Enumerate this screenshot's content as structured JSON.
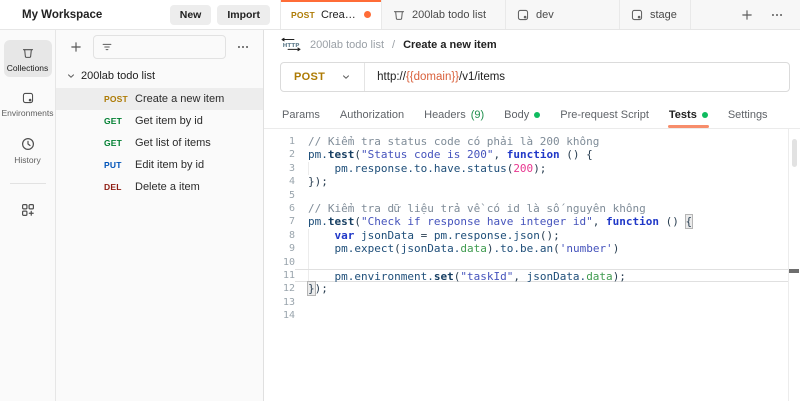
{
  "colors": {
    "accent_orange": "#ff6c37",
    "method_post": "#ad7a03",
    "method_get": "#007f31",
    "method_put": "#0053b8",
    "method_del": "#8e1a10",
    "green_dot": "#0fbb5f",
    "url_variable": "#d9603b"
  },
  "topbar": {
    "workspace": "My Workspace",
    "new_button": "New",
    "import_button": "Import",
    "tabs": [
      {
        "kind": "request",
        "method": "POST",
        "label": "Create a new item",
        "active": true,
        "dirty": true
      },
      {
        "kind": "collection",
        "label": "200lab todo list",
        "active": false,
        "dirty": false
      },
      {
        "kind": "environment",
        "label": "dev",
        "active": false,
        "dirty": false
      },
      {
        "kind": "environment",
        "label": "stage",
        "active": false,
        "dirty": false
      }
    ]
  },
  "rail": {
    "items": [
      {
        "id": "collections",
        "label": "Collections",
        "active": true
      },
      {
        "id": "environments",
        "label": "Environments",
        "active": false
      },
      {
        "id": "history",
        "label": "History",
        "active": false
      }
    ]
  },
  "sidebar": {
    "collection_name": "200lab todo list",
    "requests": [
      {
        "method": "POST",
        "label": "Create a new item",
        "selected": true
      },
      {
        "method": "GET",
        "label": "Get item by id",
        "selected": false
      },
      {
        "method": "GET",
        "label": "Get list of items",
        "selected": false
      },
      {
        "method": "PUT",
        "label": "Edit item by id",
        "selected": false
      },
      {
        "method": "DEL",
        "label": "Delete a item",
        "selected": false
      }
    ]
  },
  "request": {
    "breadcrumb": {
      "collection": "200lab todo list",
      "separator": "/",
      "name": "Create a new item"
    },
    "method": "POST",
    "url_parts": [
      {
        "type": "plain",
        "text": "http://"
      },
      {
        "type": "variable",
        "text": "{{domain}}"
      },
      {
        "type": "plain",
        "text": "/v1/items"
      }
    ],
    "tabs": [
      {
        "label": "Params",
        "active": false
      },
      {
        "label": "Authorization",
        "active": false
      },
      {
        "label": "Headers",
        "count": "(9)",
        "active": false
      },
      {
        "label": "Body",
        "dot": true,
        "active": false
      },
      {
        "label": "Pre-request Script",
        "active": false
      },
      {
        "label": "Tests",
        "dot": true,
        "active": true
      },
      {
        "label": "Settings",
        "active": false
      }
    ]
  },
  "editor": {
    "lines": [
      {
        "n": 1,
        "tokens": [
          {
            "c": "cm",
            "t": "// Kiểm tra status code có phải là 200 không"
          }
        ]
      },
      {
        "n": 2,
        "tokens": [
          {
            "c": "id",
            "t": "pm."
          },
          {
            "c": "fn",
            "t": "test"
          },
          {
            "c": "pn",
            "t": "("
          },
          {
            "c": "str",
            "t": "\"Status code is 200\""
          },
          {
            "c": "pn",
            "t": ", "
          },
          {
            "c": "kw",
            "t": "function"
          },
          {
            "c": "pn",
            "t": " () {"
          }
        ]
      },
      {
        "n": 3,
        "guide": true,
        "tokens": [
          {
            "c": "pn",
            "t": "    "
          },
          {
            "c": "id",
            "t": "pm.response.to.have.status"
          },
          {
            "c": "pn",
            "t": "("
          },
          {
            "c": "num",
            "t": "200"
          },
          {
            "c": "pn",
            "t": ");"
          }
        ]
      },
      {
        "n": 4,
        "tokens": [
          {
            "c": "pn",
            "t": "});"
          }
        ]
      },
      {
        "n": 5,
        "tokens": []
      },
      {
        "n": 6,
        "tokens": [
          {
            "c": "cm",
            "t": "// Kiểm tra dữ liệu trả về có id là số nguyên không"
          }
        ]
      },
      {
        "n": 7,
        "tokens": [
          {
            "c": "id",
            "t": "pm."
          },
          {
            "c": "fn",
            "t": "test"
          },
          {
            "c": "pn",
            "t": "("
          },
          {
            "c": "str",
            "t": "\"Check if response have integer id\""
          },
          {
            "c": "pn",
            "t": ", "
          },
          {
            "c": "kw",
            "t": "function"
          },
          {
            "c": "pn",
            "t": " () "
          },
          {
            "c": "bk",
            "t": "{"
          }
        ]
      },
      {
        "n": 8,
        "guide": true,
        "tokens": [
          {
            "c": "pn",
            "t": "    "
          },
          {
            "c": "kw",
            "t": "var"
          },
          {
            "c": "id",
            "t": " jsonData "
          },
          {
            "c": "pn",
            "t": "="
          },
          {
            "c": "id",
            "t": " pm.response.json"
          },
          {
            "c": "pn",
            "t": "();"
          }
        ]
      },
      {
        "n": 9,
        "guide": true,
        "tokens": [
          {
            "c": "pn",
            "t": "    "
          },
          {
            "c": "id",
            "t": "pm.expect"
          },
          {
            "c": "pn",
            "t": "("
          },
          {
            "c": "id",
            "t": "jsonData."
          },
          {
            "c": "prop",
            "t": "data"
          },
          {
            "c": "pn",
            "t": ")"
          },
          {
            "c": "id",
            "t": ".to.be.an"
          },
          {
            "c": "pn",
            "t": "("
          },
          {
            "c": "str",
            "t": "'number'"
          },
          {
            "c": "pn",
            "t": ")"
          }
        ]
      },
      {
        "n": 10,
        "guide": true,
        "tokens": []
      },
      {
        "n": 11,
        "guide": true,
        "cur": true,
        "tokens": [
          {
            "c": "pn",
            "t": "    "
          },
          {
            "c": "id",
            "t": "pm.environment."
          },
          {
            "c": "fn",
            "t": "set"
          },
          {
            "c": "pn",
            "t": "("
          },
          {
            "c": "str",
            "t": "\"taskId\""
          },
          {
            "c": "pn",
            "t": ", "
          },
          {
            "c": "id",
            "t": "jsonData."
          },
          {
            "c": "prop",
            "t": "data"
          },
          {
            "c": "pn",
            "t": ");"
          }
        ]
      },
      {
        "n": 12,
        "tokens": [
          {
            "c": "bk",
            "t": "}"
          },
          {
            "c": "pn",
            "t": ");"
          }
        ]
      },
      {
        "n": 13,
        "tokens": []
      },
      {
        "n": 14,
        "tokens": []
      }
    ]
  }
}
